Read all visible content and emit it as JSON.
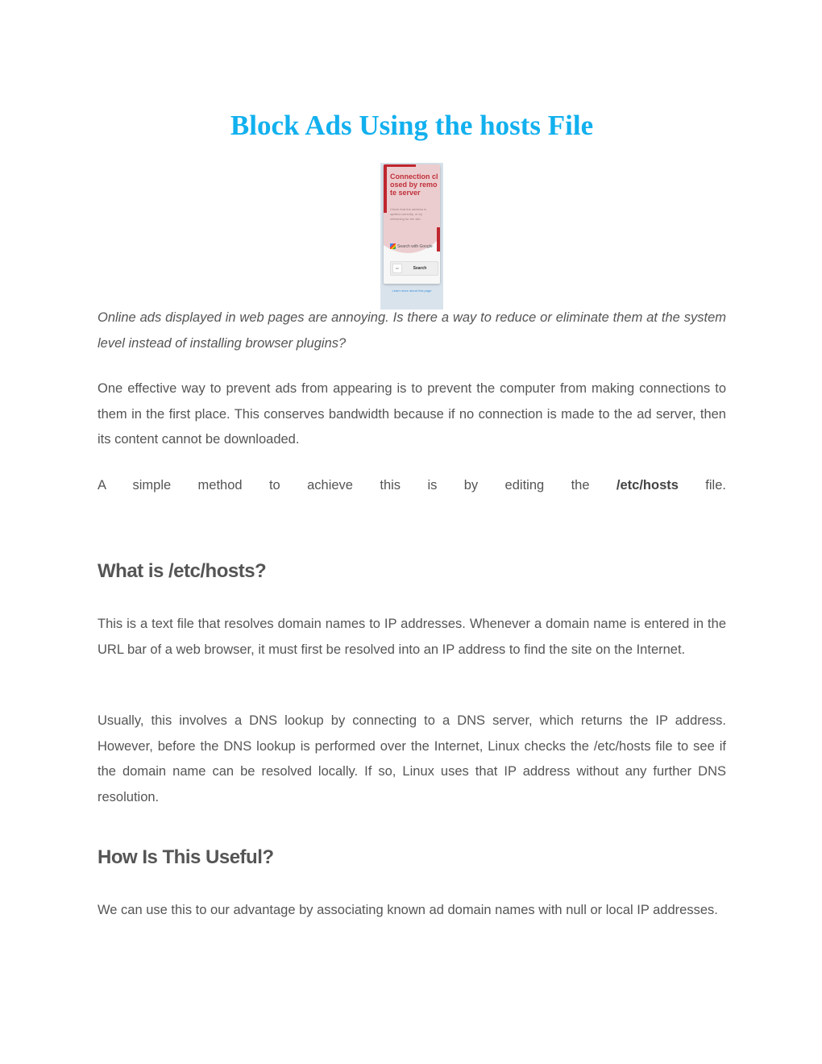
{
  "document": {
    "title": "Block Ads Using the hosts File",
    "title_color": "#12b0ee",
    "hero_image": {
      "description": "Browser error page screenshot",
      "heading": "Connection closed by remote server",
      "body": "Check that the address is spelled correctly, or try refreshing for the site.",
      "google_label": "Search with Google",
      "input_value": "sc",
      "search_button": "Search",
      "learn_more": "Learn more about this page"
    },
    "intro": "Online ads displayed in web pages are annoying. Is there a way to reduce or eliminate them at the system level instead of installing browser plugins?",
    "paragraph_1": "One effective way to prevent ads from appearing is to prevent the computer from making connections to them in the first place. This conserves bandwidth because if no connection is made to the ad server, then its content cannot be downloaded.",
    "paragraph_2": {
      "before": "A simple method to achieve this is by editing the ",
      "bold": "/etc/hosts",
      "after": " file."
    },
    "sections": [
      {
        "heading": "What is /etc/hosts?",
        "paragraphs": [
          "This is a text file that resolves domain names to IP addresses. Whenever a domain name is entered in the URL bar of a web browser, it must first be resolved into an IP address to find the site on the Internet.",
          "Usually, this involves a DNS lookup by connecting to a DNS server, which returns the IP address. However, before the DNS lookup is performed over the Internet, Linux checks the /etc/hosts file to see if the domain name can be resolved locally. If so, Linux uses that IP address without any further DNS resolution."
        ]
      },
      {
        "heading": "How Is This Useful?",
        "paragraphs": [
          "We can use this to our advantage by associating known ad domain names with null or local IP addresses."
        ]
      }
    ]
  }
}
